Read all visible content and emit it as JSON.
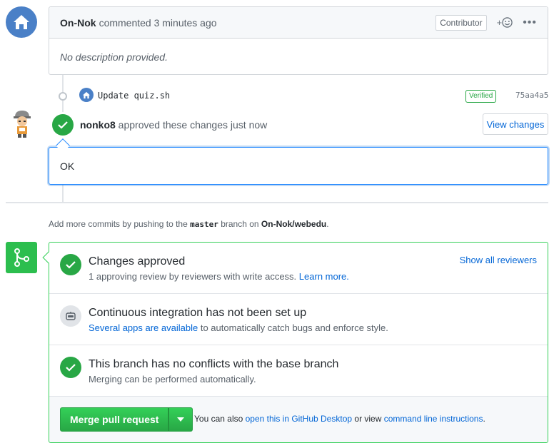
{
  "comment": {
    "author": "On-Nok",
    "action": "commented 3 minutes ago",
    "role_label": "Contributor",
    "reaction_plus": "+",
    "reaction_icon": "smiley-icon",
    "more_icon": "kebab-icon",
    "more_label": "•••",
    "body": "No description provided."
  },
  "commit": {
    "message": "Update quiz.sh",
    "verified_label": "Verified",
    "sha": "75aa4a5"
  },
  "review": {
    "reviewer": "nonko8",
    "action": "approved these changes just now",
    "view_changes_label": "View changes",
    "body": "OK"
  },
  "push_hint": {
    "prefix": "Add more commits by pushing to the",
    "branch": "master",
    "middle": "branch on",
    "repo": "On-Nok/webedu",
    "suffix": "."
  },
  "merge": {
    "approved": {
      "title": "Changes approved",
      "desc": "1 approving review by reviewers with write access.",
      "learn_more": "Learn more.",
      "show_all": "Show all reviewers"
    },
    "ci": {
      "title": "Continuous integration has not been set up",
      "link": "Several apps are available",
      "desc": "to automatically catch bugs and enforce style."
    },
    "conflicts": {
      "title": "This branch has no conflicts with the base branch",
      "desc": "Merging can be performed automatically."
    },
    "footer": {
      "button_label": "Merge pull request",
      "alt_prefix": "You can also",
      "alt_link1": "open this in GitHub Desktop",
      "alt_middle": "or view",
      "alt_link2": "command line instructions",
      "alt_suffix": "."
    }
  },
  "colors": {
    "success": "#28a745",
    "link": "#0366d6",
    "avatar_blue": "#4a80c7"
  }
}
